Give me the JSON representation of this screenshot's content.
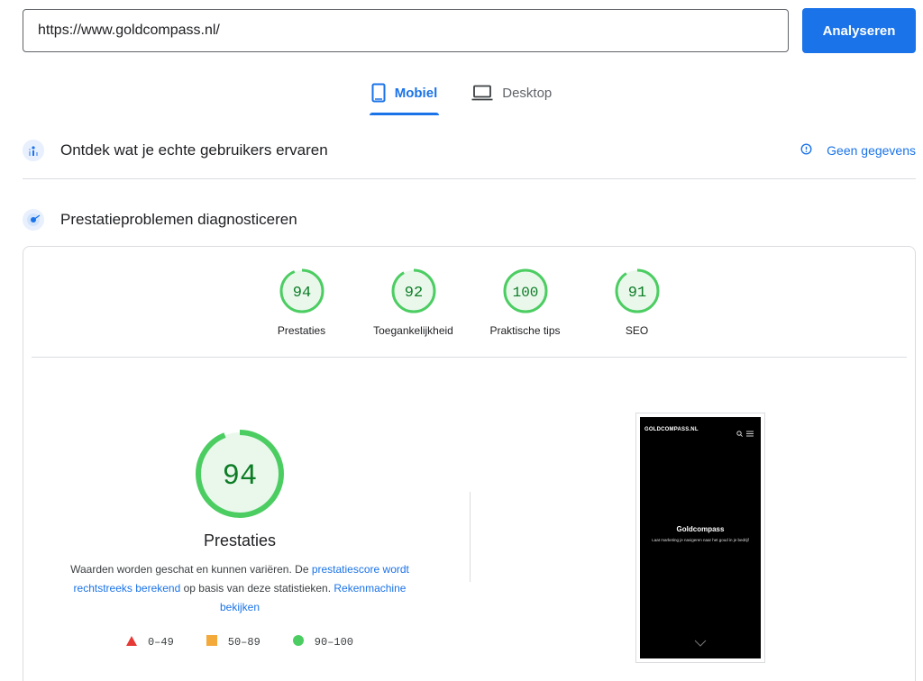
{
  "search": {
    "url": "https://www.goldcompass.nl/",
    "button_label": "Analyseren"
  },
  "tabs": [
    {
      "label": "Mobiel",
      "icon": "phone-icon",
      "active": true
    },
    {
      "label": "Desktop",
      "icon": "laptop-icon",
      "active": false
    }
  ],
  "field_data": {
    "title": "Ontdek wat je echte gebruikers ervaren",
    "no_data_label": "Geen gegevens"
  },
  "diagnose": {
    "title": "Prestatieproblemen diagnosticeren"
  },
  "scores": [
    {
      "value": "94",
      "label": "Prestaties",
      "fraction": 0.94
    },
    {
      "value": "92",
      "label": "Toegankelijkheid",
      "fraction": 0.92
    },
    {
      "value": "100",
      "label": "Praktische tips",
      "fraction": 1.0
    },
    {
      "value": "91",
      "label": "SEO",
      "fraction": 0.91
    }
  ],
  "performance": {
    "score": "94",
    "fraction": 0.94,
    "title": "Prestaties",
    "desc_prefix": "Waarden worden geschat en kunnen variëren. De ",
    "link1": "prestatiescore wordt rechtstreeks berekend",
    "desc_middle": " op basis van deze statistieken. ",
    "link2": "Rekenmachine bekijken"
  },
  "legend": [
    {
      "range": "0–49",
      "color": "#e53935",
      "shape": "triangle"
    },
    {
      "range": "50–89",
      "color": "#f4a93b",
      "shape": "square"
    },
    {
      "range": "90–100",
      "color": "#4ccd62",
      "shape": "circle"
    }
  ],
  "screenshot": {
    "brand": "GOLDCOMPASS.NL",
    "hero_title": "Goldcompass",
    "hero_subtitle": "Laat marketing je navigeren naar het goud in je bedrijf"
  },
  "colors": {
    "accent": "#1a73e8",
    "good": "#0c7c25",
    "good_ring": "#4ccd62",
    "good_fill": "#eaf8ec"
  }
}
